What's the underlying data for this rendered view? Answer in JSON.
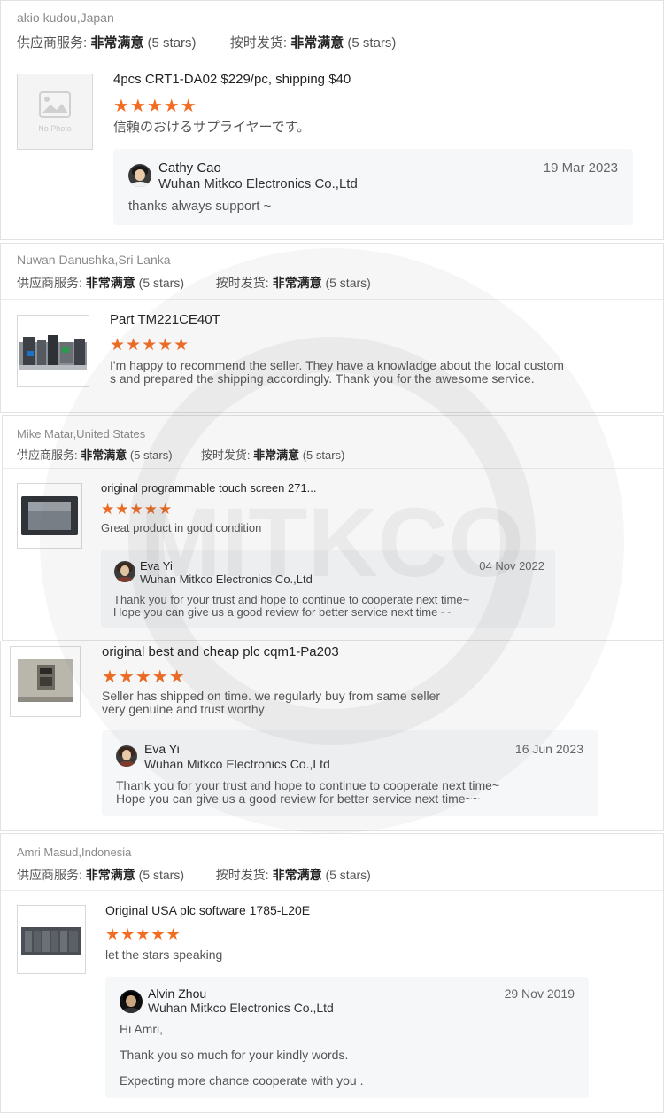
{
  "labels": {
    "service": "供应商服务:",
    "delivery": "按时发货:",
    "very_satisfied": "非常满意",
    "five_stars": "(5 stars)",
    "star_glyphs": "★★★★★",
    "no_photo": "No Photo"
  },
  "reviews": [
    {
      "buyer": "akio kudou,Japan",
      "product": "4pcs CRT1-DA02 $229/pc, shipping $40",
      "comment": "信頼のおけるサプライヤーです。",
      "reply": {
        "name": "Cathy Cao",
        "company": "Wuhan Mitkco Electronics Co.,Ltd",
        "date": "19 Mar 2023",
        "text": "thanks always support ~"
      }
    },
    {
      "buyer": "Nuwan Danushka,Sri Lanka",
      "product": "Part TM221CE40T",
      "comment_line1": "I'm happy to recommend the seller. They have a knowladge about the local custom",
      "comment_line2": "s and prepared the shipping accordingly. Thank you for the awesome service."
    },
    {
      "buyer": "Mike Matar,United States",
      "product": "original programmable touch screen 271...",
      "comment": "Great product in good condition",
      "reply": {
        "name": "Eva Yi",
        "company": "Wuhan Mitkco Electronics Co.,Ltd",
        "date": "04 Nov 2022",
        "text_line1": "Thank you for your trust and hope to continue to cooperate next time~",
        "text_line2": "Hope you can give us a good review for better service next time~~"
      }
    },
    {
      "product": "original best and cheap plc cqm1-Pa203",
      "comment_line1": "Seller has shipped on time. we regularly buy from same seller",
      "comment_line2": "very genuine and trust worthy",
      "reply": {
        "name": "Eva Yi",
        "company": "Wuhan Mitkco Electronics Co.,Ltd",
        "date": "16 Jun 2023",
        "text_line1": "Thank you for your trust and hope to continue to cooperate next time~",
        "text_line2": "Hope you can give us a good review for better service next time~~"
      }
    },
    {
      "buyer": "Amri Masud,Indonesia",
      "product": "Original USA plc software 1785-L20E",
      "comment": "let the stars speaking",
      "reply": {
        "name": "Alvin Zhou",
        "company": "Wuhan Mitkco Electronics Co.,Ltd",
        "date": "29 Nov 2019",
        "text_line1": "Hi Amri,",
        "text_line2": "Thank you so much for your kindly words.",
        "text_line3": "Expecting more chance cooperate with you ."
      }
    }
  ],
  "watermark_text": "MITKCO",
  "colors": {
    "star": "#f26c22",
    "reply_bg": "#f6f7f9"
  }
}
